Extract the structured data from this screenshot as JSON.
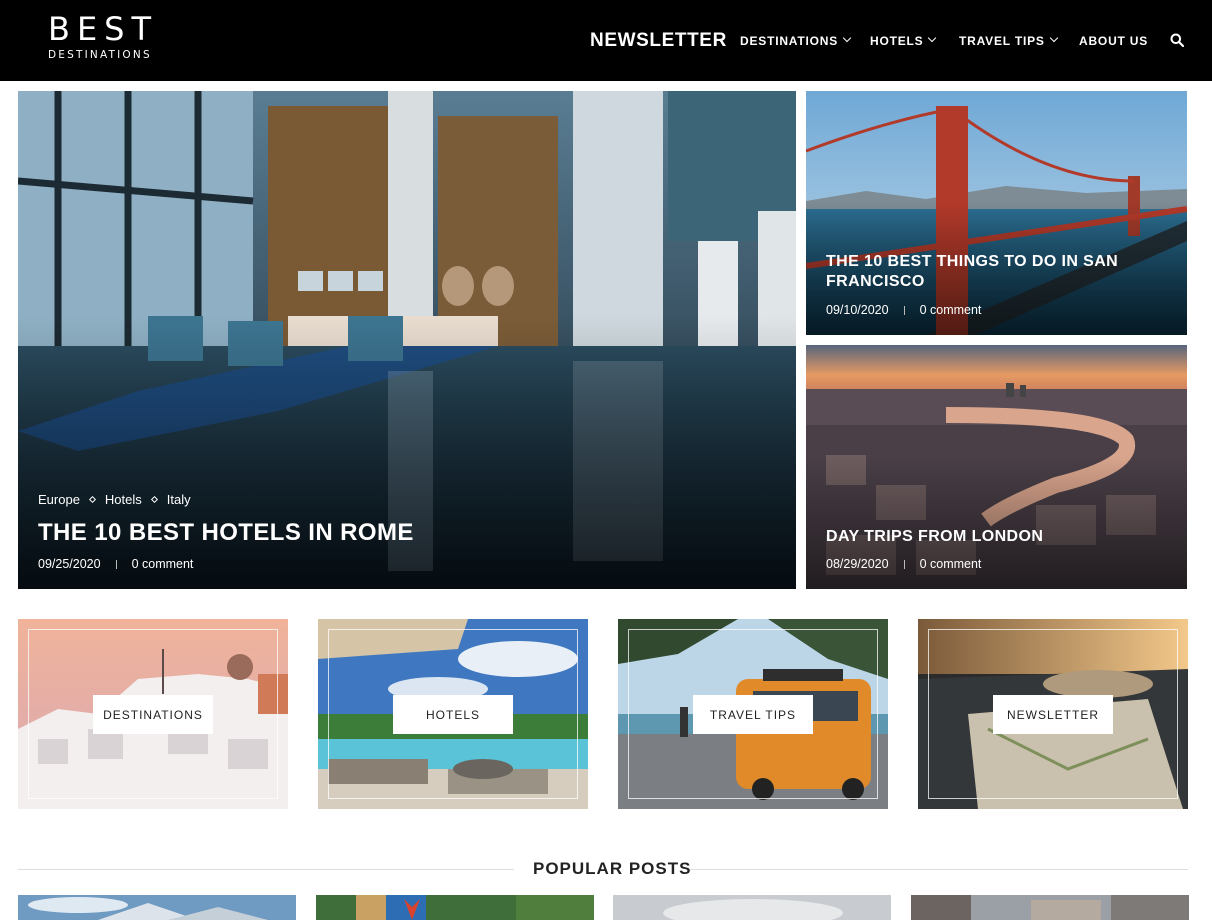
{
  "brand": {
    "name_main": "BEST",
    "name_sub": "DESTINATIONS"
  },
  "nav": {
    "newsletter": "NEWSLETTER",
    "items": [
      {
        "label": "DESTINATIONS",
        "has_dropdown": true
      },
      {
        "label": "HOTELS",
        "has_dropdown": true
      },
      {
        "label": "TRAVEL TIPS",
        "has_dropdown": true
      },
      {
        "label": "ABOUT US",
        "has_dropdown": false
      }
    ],
    "search_icon": "search-icon"
  },
  "featured": {
    "main": {
      "categories": [
        "Europe",
        "Hotels",
        "Italy"
      ],
      "title": "THE 10 BEST HOTELS IN ROME",
      "date": "09/25/2020",
      "comments": "0 comment"
    },
    "side": [
      {
        "title": "THE 10 BEST THINGS TO DO IN SAN FRANCISCO",
        "date": "09/10/2020",
        "comments": "0 comment"
      },
      {
        "title": "DAY TRIPS FROM LONDON",
        "date": "08/29/2020",
        "comments": "0 comment"
      }
    ]
  },
  "categories": [
    {
      "label": "DESTINATIONS"
    },
    {
      "label": "HOTELS"
    },
    {
      "label": "TRAVEL TIPS"
    },
    {
      "label": "NEWSLETTER"
    }
  ],
  "popular": {
    "heading": "POPULAR POSTS"
  },
  "colors": {
    "header_bg": "#000000",
    "text_white": "#ffffff",
    "dark_text": "#222222"
  }
}
